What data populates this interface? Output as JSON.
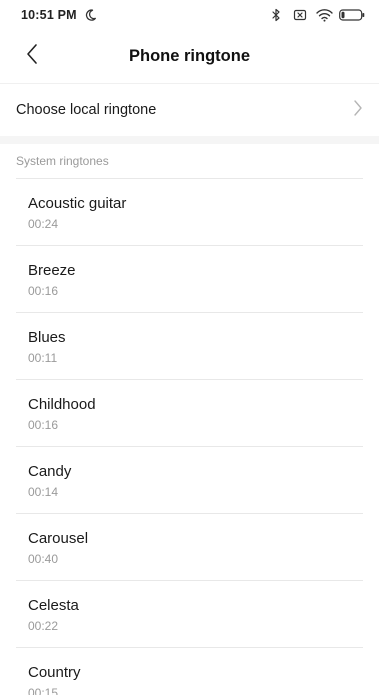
{
  "status_bar": {
    "time": "10:51 PM",
    "icons": [
      "moon-icon",
      "bluetooth-icon",
      "no-sim-icon",
      "wifi-icon",
      "battery-icon"
    ]
  },
  "header": {
    "title": "Phone ringtone",
    "back_icon": "chevron-left-icon"
  },
  "local": {
    "label": "Choose local ringtone",
    "icon": "chevron-right-icon"
  },
  "section": {
    "title": "System ringtones"
  },
  "ringtones": [
    {
      "name": "Acoustic guitar",
      "duration": "00:24"
    },
    {
      "name": "Breeze",
      "duration": "00:16"
    },
    {
      "name": "Blues",
      "duration": "00:11"
    },
    {
      "name": "Childhood",
      "duration": "00:16"
    },
    {
      "name": "Candy",
      "duration": "00:14"
    },
    {
      "name": "Carousel",
      "duration": "00:40"
    },
    {
      "name": "Celesta",
      "duration": "00:22"
    },
    {
      "name": "Country",
      "duration": "00:15"
    }
  ],
  "colors": {
    "text_primary": "#1a1a1a",
    "text_secondary": "#9a9a9a",
    "divider": "#e8e8e8",
    "band": "#f5f5f5"
  }
}
